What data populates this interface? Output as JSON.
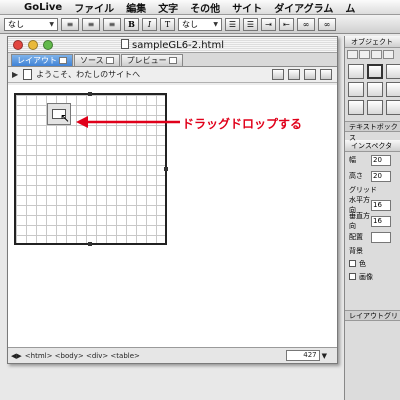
{
  "menubar": {
    "app_name": "GoLive",
    "items": [
      "ファイル",
      "編集",
      "文字",
      "その他",
      "サイト",
      "ダイアグラム",
      "ム"
    ]
  },
  "toolbar": {
    "paragraph_select": "なし",
    "bold": "B",
    "italic": "I",
    "teletype": "T",
    "font_select": "なし"
  },
  "document": {
    "filename": "sampleGL6-2.html",
    "tabs": [
      "レイアウト",
      "ソース",
      "プレビュー"
    ],
    "page_title": "ようこそ、わたしのサイトへ",
    "status_path": "<html> <body> <div> <table>",
    "width_value": "427"
  },
  "palette": {
    "objects_title": "オブジェクト",
    "textbox_label": "テキストボックス",
    "inspector_title": "インスペクタ",
    "width_label": "幅",
    "width_value": "20",
    "height_label": "高さ",
    "height_value": "20",
    "grid_label": "グリッド",
    "horizontal_label": "水平方向",
    "horizontal_value": "16",
    "vertical_label": "垂直方向",
    "vertical_value": "16",
    "align_label": "配置",
    "background_label": "背景",
    "color_label": "色",
    "image_label": "画像",
    "layout_grid_label": "レイアウトグリ"
  },
  "annotation": {
    "text": "ドラッグドロップする",
    "color": "#e0001a"
  }
}
